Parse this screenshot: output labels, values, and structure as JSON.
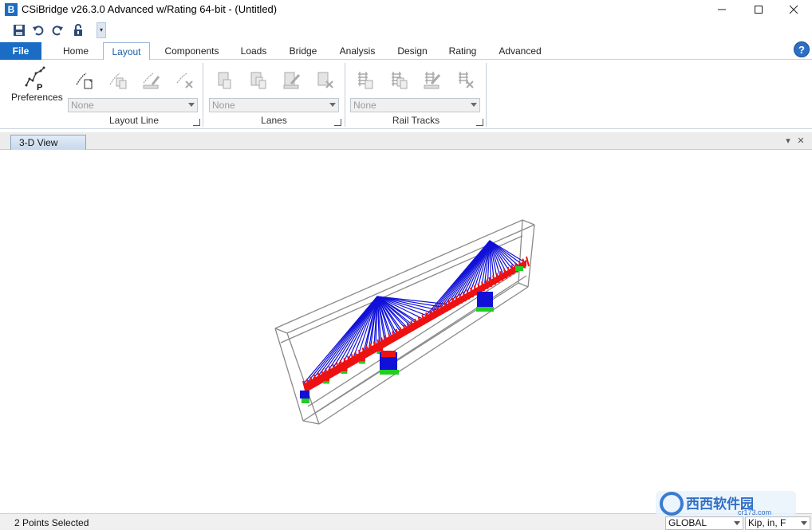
{
  "window": {
    "title": "CSiBridge v26.3.0 Advanced w/Rating 64-bit - (Untitled)",
    "logo_letter": "B"
  },
  "qat": {
    "items": [
      "save-icon",
      "undo-icon",
      "redo-icon",
      "lock-icon"
    ]
  },
  "tabs": [
    {
      "label": "File",
      "kind": "file"
    },
    {
      "label": "Home"
    },
    {
      "label": "Layout",
      "active": true
    },
    {
      "label": "Components"
    },
    {
      "label": "Loads"
    },
    {
      "label": "Bridge"
    },
    {
      "label": "Analysis"
    },
    {
      "label": "Design"
    },
    {
      "label": "Rating"
    },
    {
      "label": "Advanced"
    }
  ],
  "help_label": "?",
  "ribbon": {
    "preferences_label": "Preferences",
    "preferences_icon_letter": "P",
    "layout_line": {
      "label": "Layout Line",
      "combo_value": "None"
    },
    "lanes": {
      "label": "Lanes",
      "combo_value": "None"
    },
    "rail_tracks": {
      "label": "Rail Tracks",
      "combo_value": "None"
    }
  },
  "view": {
    "tab_label": "3-D View"
  },
  "model_colors": {
    "cables": "#1010d8",
    "deck": "#ee1111",
    "supports": "#22cc22",
    "bounding_box": "#8a8a8a"
  },
  "status": {
    "selection_text": "2 Points Selected",
    "coord_system": "GLOBAL",
    "units": "Kip, in, F"
  },
  "watermark": {
    "site": "cr173.com",
    "text": "西西软件园"
  }
}
